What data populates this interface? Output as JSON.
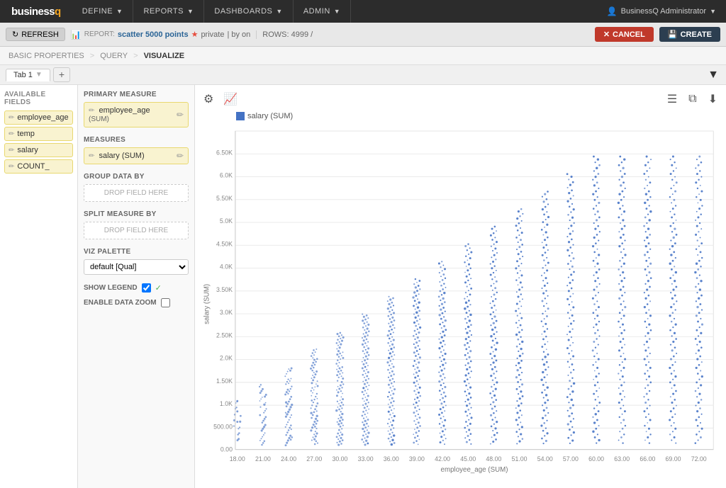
{
  "app": {
    "logo_text": "business",
    "logo_accent": "q"
  },
  "nav": {
    "items": [
      {
        "label": "DEFINE",
        "id": "define"
      },
      {
        "label": "REPORTS",
        "id": "reports"
      },
      {
        "label": "DASHBOARDS",
        "id": "dashboards"
      },
      {
        "label": "ADMIN",
        "id": "admin"
      }
    ],
    "user": "BusinessQ Administrator"
  },
  "toolbar": {
    "refresh_label": "REFRESH",
    "report_label": "REPORT:",
    "report_name": "scatter 5000 points",
    "private_label": "private",
    "by_label": "| by on",
    "rows_label": "ROWS: 4999 /",
    "cancel_label": "CANCEL",
    "create_label": "CREATE"
  },
  "breadcrumb": {
    "steps": [
      "BASIC PROPERTIES",
      "QUERY",
      "VISUALIZE"
    ],
    "active": "VISUALIZE"
  },
  "tabs": {
    "tab1_label": "Tab 1",
    "add_label": "+"
  },
  "available_fields": {
    "title": "AVAILABLE FIELDS",
    "fields": [
      {
        "name": "employee_age"
      },
      {
        "name": "temp"
      },
      {
        "name": "salary"
      },
      {
        "name": "COUNT_"
      }
    ]
  },
  "config": {
    "primary_measure_title": "PRIMARY MEASURE",
    "primary_measure_field": "employee_age",
    "primary_measure_agg": "(SUM)",
    "measures_title": "MEASURES",
    "measure_field": "salary (SUM)",
    "group_data_title": "GROUP DATA BY",
    "group_data_placeholder": "DROP FIELD HERE",
    "split_measure_title": "SPLIT MEASURE BY",
    "split_measure_placeholder": "DROP FIELD HERE",
    "viz_palette_title": "VIZ PALETTE",
    "viz_palette_value": "default [Qual]",
    "show_legend_label": "SHOW LEGEND",
    "enable_zoom_label": "ENABLE DATA ZOOM"
  },
  "chart": {
    "legend_label": "salary (SUM)",
    "x_axis_label": "employee_age (SUM)",
    "y_axis_label": "salary (SUM)",
    "x_ticks": [
      "18.00",
      "21.00",
      "24.00",
      "27.00",
      "30.00",
      "33.00",
      "36.00",
      "39.00",
      "42.00",
      "45.00",
      "48.00",
      "51.00",
      "54.00",
      "57.00",
      "60.00",
      "63.00",
      "66.00",
      "69.00",
      "72.00"
    ],
    "y_ticks": [
      "0.00",
      "500.00",
      "1.0K",
      "1.50K",
      "2.0K",
      "2.50K",
      "3.0K",
      "3.50K",
      "4.0K",
      "4.50K",
      "5.0K",
      "5.50K",
      "6.0K",
      "6.50K"
    ],
    "dot_color": "#4472c4"
  }
}
